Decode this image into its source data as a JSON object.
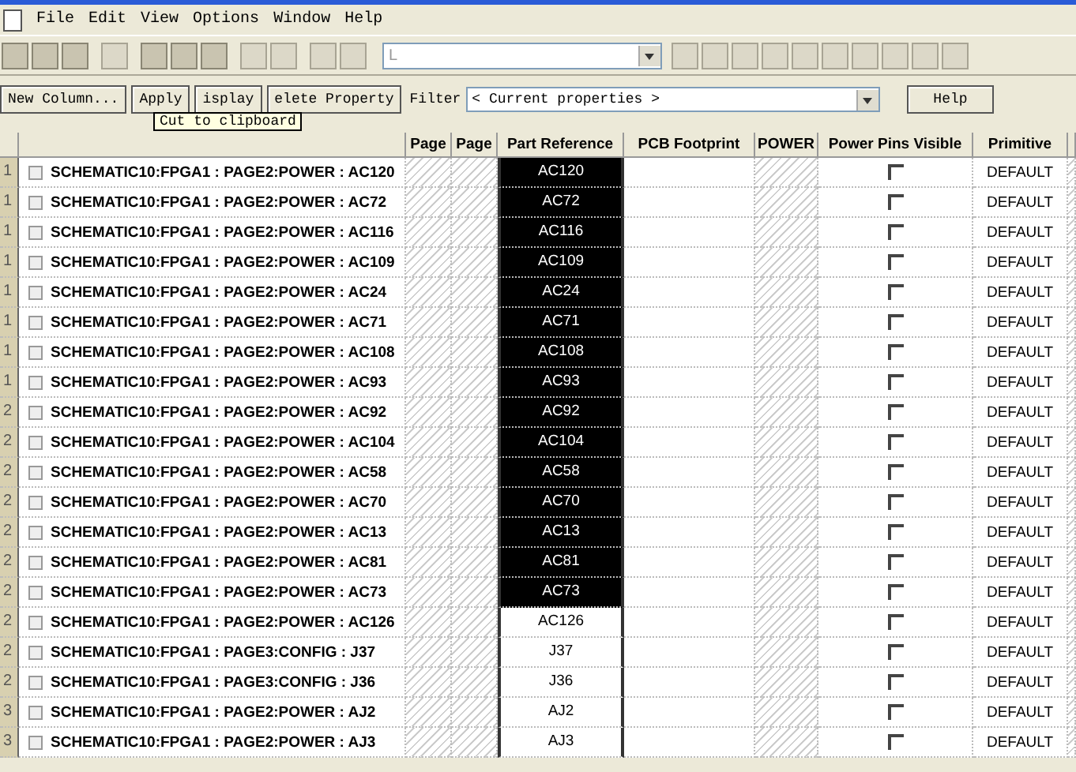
{
  "menu": [
    "File",
    "Edit",
    "View",
    "Options",
    "Window",
    "Help"
  ],
  "toolbar": {
    "combo_value": "L"
  },
  "actions": [
    "New Column...",
    "Apply",
    "isplay",
    "elete Property"
  ],
  "filter": {
    "label": "Filter",
    "value": "< Current properties >",
    "help": "Help"
  },
  "tooltip": "Cut to clipboard",
  "table": {
    "columns": [
      "Page",
      "Page",
      "Part Reference",
      "PCB Footprint",
      "POWER",
      "Power Pins Visible",
      "Primitive"
    ],
    "rows": [
      {
        "num": "1",
        "name": "SCHEMATIC10:FPGA1 : PAGE2:POWER : AC120",
        "part": "AC120",
        "selected": true,
        "power_pins_visible": false,
        "primitive": "DEFAULT"
      },
      {
        "num": "1",
        "name": "SCHEMATIC10:FPGA1 : PAGE2:POWER : AC72",
        "part": "AC72",
        "selected": true,
        "power_pins_visible": false,
        "primitive": "DEFAULT"
      },
      {
        "num": "1",
        "name": "SCHEMATIC10:FPGA1 : PAGE2:POWER : AC116",
        "part": "AC116",
        "selected": true,
        "power_pins_visible": false,
        "primitive": "DEFAULT"
      },
      {
        "num": "1",
        "name": "SCHEMATIC10:FPGA1 : PAGE2:POWER : AC109",
        "part": "AC109",
        "selected": true,
        "power_pins_visible": false,
        "primitive": "DEFAULT"
      },
      {
        "num": "1",
        "name": "SCHEMATIC10:FPGA1 : PAGE2:POWER : AC24",
        "part": "AC24",
        "selected": true,
        "power_pins_visible": false,
        "primitive": "DEFAULT"
      },
      {
        "num": "1",
        "name": "SCHEMATIC10:FPGA1 : PAGE2:POWER : AC71",
        "part": "AC71",
        "selected": true,
        "power_pins_visible": false,
        "primitive": "DEFAULT"
      },
      {
        "num": "1",
        "name": "SCHEMATIC10:FPGA1 : PAGE2:POWER : AC108",
        "part": "AC108",
        "selected": true,
        "power_pins_visible": false,
        "primitive": "DEFAULT"
      },
      {
        "num": "1",
        "name": "SCHEMATIC10:FPGA1 : PAGE2:POWER : AC93",
        "part": "AC93",
        "selected": true,
        "power_pins_visible": false,
        "primitive": "DEFAULT"
      },
      {
        "num": "2",
        "name": "SCHEMATIC10:FPGA1 : PAGE2:POWER : AC92",
        "part": "AC92",
        "selected": true,
        "power_pins_visible": false,
        "primitive": "DEFAULT"
      },
      {
        "num": "2",
        "name": "SCHEMATIC10:FPGA1 : PAGE2:POWER : AC104",
        "part": "AC104",
        "selected": true,
        "power_pins_visible": false,
        "primitive": "DEFAULT"
      },
      {
        "num": "2",
        "name": "SCHEMATIC10:FPGA1 : PAGE2:POWER : AC58",
        "part": "AC58",
        "selected": true,
        "power_pins_visible": false,
        "primitive": "DEFAULT"
      },
      {
        "num": "2",
        "name": "SCHEMATIC10:FPGA1 : PAGE2:POWER : AC70",
        "part": "AC70",
        "selected": true,
        "power_pins_visible": false,
        "primitive": "DEFAULT"
      },
      {
        "num": "2",
        "name": "SCHEMATIC10:FPGA1 : PAGE2:POWER : AC13",
        "part": "AC13",
        "selected": true,
        "power_pins_visible": false,
        "primitive": "DEFAULT"
      },
      {
        "num": "2",
        "name": "SCHEMATIC10:FPGA1 : PAGE2:POWER : AC81",
        "part": "AC81",
        "selected": true,
        "power_pins_visible": false,
        "primitive": "DEFAULT"
      },
      {
        "num": "2",
        "name": "SCHEMATIC10:FPGA1 : PAGE2:POWER : AC73",
        "part": "AC73",
        "selected": true,
        "power_pins_visible": false,
        "primitive": "DEFAULT"
      },
      {
        "num": "2",
        "name": "SCHEMATIC10:FPGA1 : PAGE2:POWER : AC126",
        "part": "AC126",
        "selected": false,
        "power_pins_visible": false,
        "primitive": "DEFAULT"
      },
      {
        "num": "2",
        "name": "SCHEMATIC10:FPGA1 : PAGE3:CONFIG : J37",
        "part": "J37",
        "selected": false,
        "power_pins_visible": false,
        "primitive": "DEFAULT"
      },
      {
        "num": "2",
        "name": "SCHEMATIC10:FPGA1 : PAGE3:CONFIG : J36",
        "part": "J36",
        "selected": false,
        "power_pins_visible": false,
        "primitive": "DEFAULT"
      },
      {
        "num": "3",
        "name": "SCHEMATIC10:FPGA1 : PAGE2:POWER : AJ2",
        "part": "AJ2",
        "selected": false,
        "power_pins_visible": false,
        "primitive": "DEFAULT"
      },
      {
        "num": "3",
        "name": "SCHEMATIC10:FPGA1 : PAGE2:POWER : AJ3",
        "part": "AJ3",
        "selected": false,
        "power_pins_visible": false,
        "primitive": "DEFAULT"
      }
    ]
  }
}
